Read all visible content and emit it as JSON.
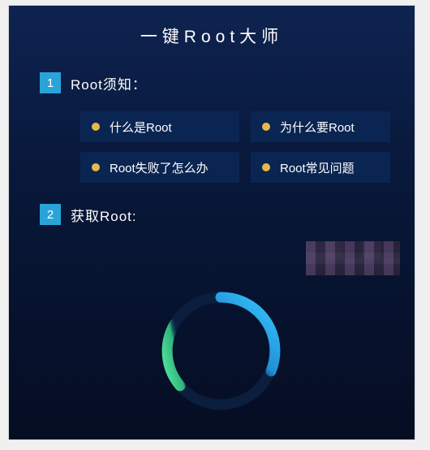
{
  "title": "一键Root大师",
  "sections": [
    {
      "step": "1",
      "title": "Root须知：",
      "topics": [
        {
          "label": "什么是Root"
        },
        {
          "label": "为什么要Root"
        },
        {
          "label": "Root失败了怎么办"
        },
        {
          "label": "Root常见问题"
        }
      ]
    },
    {
      "step": "2",
      "title": "获取Root:"
    }
  ],
  "colors": {
    "accent": "#2aa3d9",
    "bullet": "#e6b84a",
    "spinner_blue": "#2fb6ef",
    "spinner_green": "#3ccf8e"
  }
}
